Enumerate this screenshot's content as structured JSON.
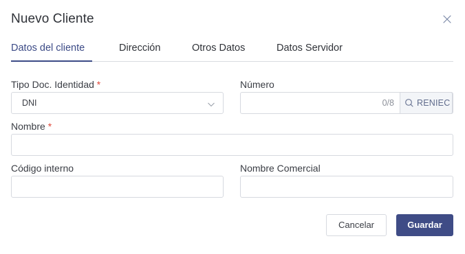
{
  "dialog": {
    "title": "Nuevo Cliente",
    "close_icon": "close-icon"
  },
  "tabs": [
    {
      "label": "Datos del cliente",
      "active": true
    },
    {
      "label": "Dirección",
      "active": false
    },
    {
      "label": "Otros Datos",
      "active": false
    },
    {
      "label": "Datos Servidor",
      "active": false
    }
  ],
  "form": {
    "tipo_doc": {
      "label": "Tipo Doc. Identidad",
      "required_mark": "*",
      "value": "DNI",
      "icon": "chevron-down-icon"
    },
    "numero": {
      "label": "Número",
      "value": "",
      "counter": "0/8",
      "search_label": "RENIEC",
      "search_icon": "search-icon"
    },
    "nombre": {
      "label": "Nombre",
      "required_mark": "*",
      "value": ""
    },
    "codigo_interno": {
      "label": "Código interno",
      "value": ""
    },
    "nombre_comercial": {
      "label": "Nombre Comercial",
      "value": ""
    }
  },
  "actions": {
    "cancel_label": "Cancelar",
    "save_label": "Guardar"
  },
  "colors": {
    "accent": "#3b4a86",
    "primary_button": "#3f4c86",
    "required": "#e0483a",
    "border": "#d6d9df"
  }
}
